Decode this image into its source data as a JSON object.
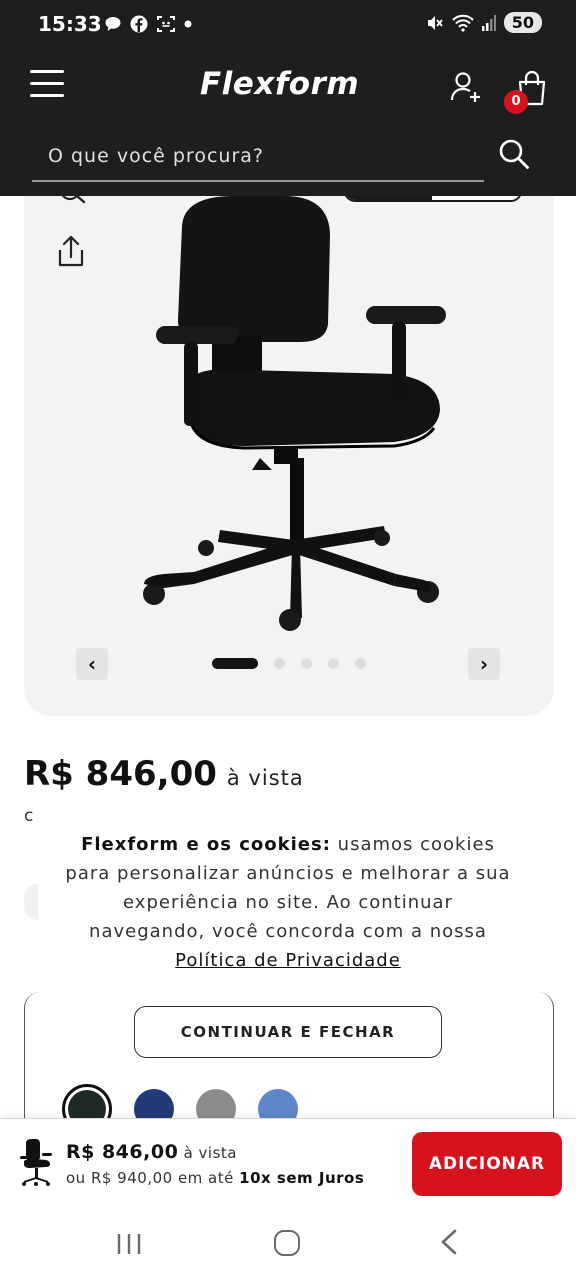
{
  "status_bar": {
    "time": "15:33",
    "battery": "50",
    "icons": [
      "message-icon",
      "facebook-icon",
      "screenshot-icon",
      "dot-icon",
      "mute-icon",
      "wifi-icon",
      "signal-icon",
      "battery-icon"
    ]
  },
  "header": {
    "logo": "Flexform",
    "cart_count": "0",
    "search_placeholder": "O que você procura?",
    "icons": [
      "menu-icon",
      "add-user-icon",
      "shopping-bag-icon",
      "search-icon"
    ]
  },
  "gallery": {
    "image": "black-office-chair",
    "slide_count": 5,
    "active_slide": 1,
    "prev_label": "‹",
    "next_label": "›",
    "icons": [
      "zoom-icon",
      "share-icon"
    ]
  },
  "price": {
    "value": "R$ 846,00",
    "suffix": "à vista",
    "cut_text": "c"
  },
  "cookie_banner": {
    "bold": "Flexform e os cookies:",
    "text": " usamos cookies para personalizar anúncios e melhorar a sua experiência no site. Ao continuar navegando, você concorda com a nossa ",
    "link": "Política de Privacidade",
    "button": "CONTINUAR E FECHAR"
  },
  "swatches": [
    {
      "color": "#1e2a28",
      "selected": true
    },
    {
      "color": "#213a78",
      "selected": false
    },
    {
      "color": "#8c8c8c",
      "selected": false
    },
    {
      "color": "#5f86c8",
      "selected": false
    }
  ],
  "bottom_bar": {
    "price": "R$ 846,00",
    "price_suffix": "à vista",
    "installment_prefix": "ou R$ 940,00 em até",
    "installment_bold": "10x sem Juros",
    "add_button": "ADICIONAR"
  },
  "colors": {
    "header_bg": "#1e1e1e",
    "accent_red": "#d6121f",
    "gallery_bg": "#f3f3f3"
  }
}
